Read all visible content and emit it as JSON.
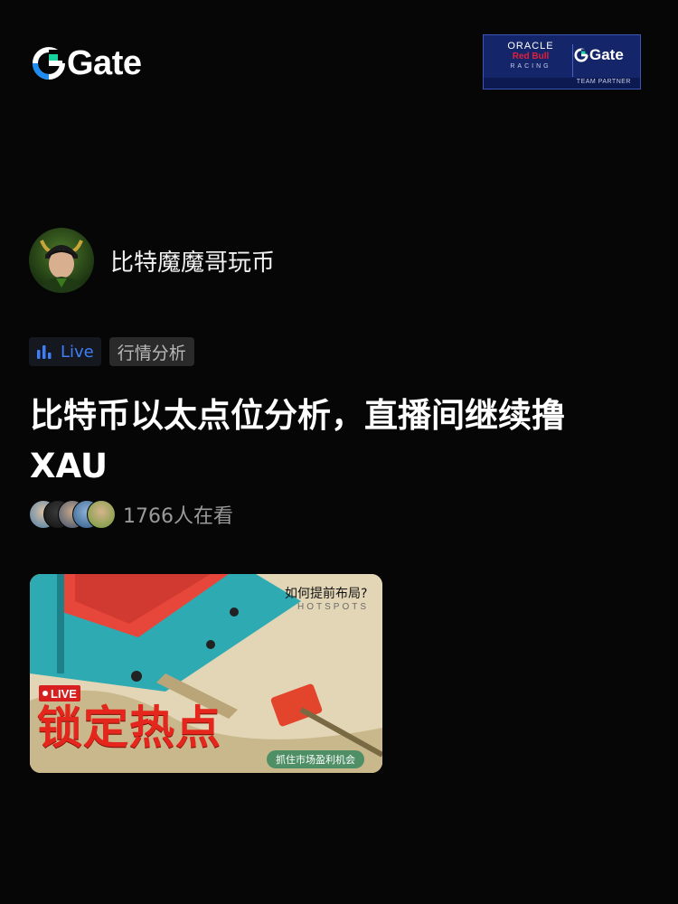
{
  "brand": {
    "name": "Gate",
    "accent_color": "#17b6f0"
  },
  "partner_badge": {
    "oracle": "ORACLE",
    "redbull": "Red Bull",
    "racing": "RACING",
    "brand": "Gate",
    "footer": "TEAM PARTNER"
  },
  "author": {
    "name": "比特魔魔哥玩币"
  },
  "tags": {
    "live": "Live",
    "category": "行情分析",
    "live_color": "#3f7ef7"
  },
  "post": {
    "title": "比特币以太点位分析，直播间继续撸 XAU"
  },
  "viewers": {
    "count_text": "1766人在看"
  },
  "thumbnail": {
    "question": "如何提前布局?",
    "hotspots": "HOTSPOTS",
    "live_badge": "LIVE",
    "headline": "锁定热点",
    "pill": "抓住市场盈利机会"
  }
}
